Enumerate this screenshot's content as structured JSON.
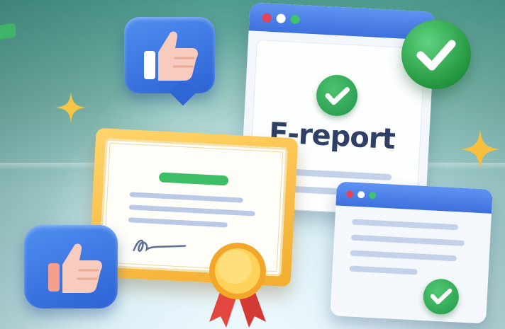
{
  "report": {
    "title": "E-report",
    "titlebar_dots": [
      "#e2445b",
      "#ffffff",
      "#3fc36b"
    ]
  },
  "small_window": {
    "titlebar_dots": [
      "#e2445b",
      "#ffffff",
      "#3fc36b"
    ]
  },
  "icons": {
    "thumbs_up": "thumbs-up-icon",
    "check": "check-icon",
    "certificate": "certificate-icon",
    "medal": "award-ribbon-icon",
    "sparkle": "sparkle-icon",
    "signature": "signature-icon"
  },
  "colors": {
    "accent_blue": "#3d70dc",
    "success_green": "#2aa052",
    "certificate_gold": "#f3ad2e",
    "ribbon_red": "#e3463f"
  }
}
